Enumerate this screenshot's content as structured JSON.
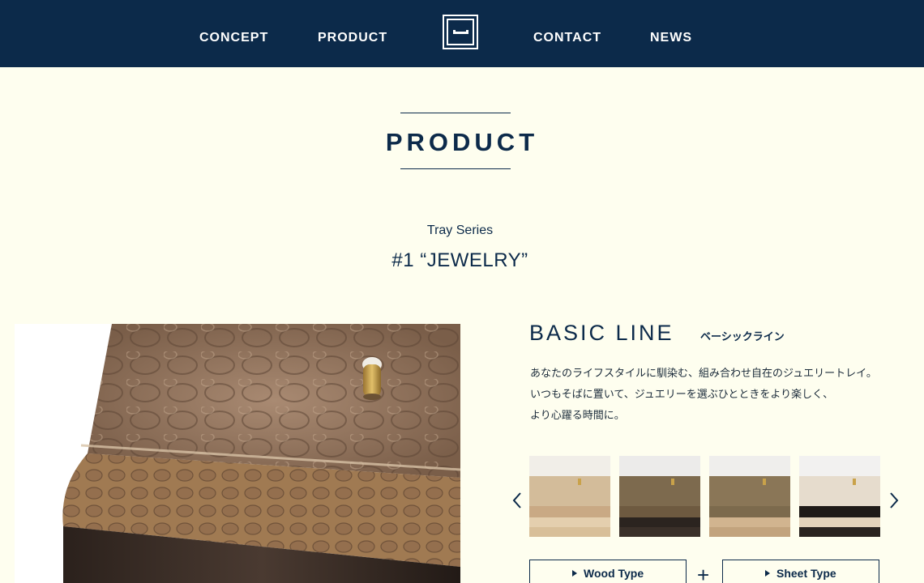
{
  "nav": {
    "concept": "CONCEPT",
    "product": "PRODUCT",
    "contact": "CONTACT",
    "news": "NEWS"
  },
  "section": {
    "title": "PRODUCT"
  },
  "product": {
    "series": "Tray Series",
    "title": "#1 “JEWELRY”"
  },
  "line": {
    "name": "BASIC LINE",
    "name_jp": "ベーシックライン",
    "description": [
      "あなたのライフスタイルに馴染む、組み合わせ自在のジュエリートレイ。",
      "いつもそばに置いて、ジュエリーを選ぶひとときをより楽しく、",
      "より心躍る時間に。"
    ]
  },
  "options": {
    "wood_type": "Wood Type",
    "plus": "+",
    "sheet_type": "Sheet Type"
  },
  "colors": {
    "navy": "#0c2a4a",
    "background": "#fefeef",
    "brass": "#c9a24a"
  }
}
